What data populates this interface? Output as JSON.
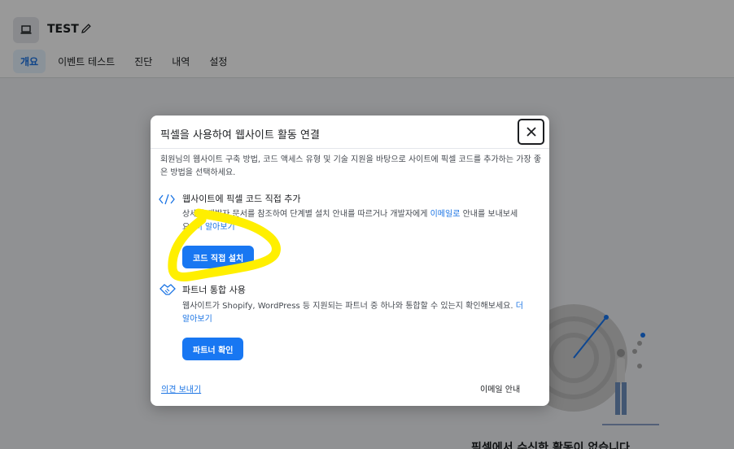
{
  "header": {
    "title": "TEST",
    "app_icon": "laptop-icon",
    "edit_icon": "pencil-icon",
    "tabs": [
      {
        "label": "개요",
        "active": true
      },
      {
        "label": "이벤트 테스트",
        "active": false
      },
      {
        "label": "진단",
        "active": false
      },
      {
        "label": "내역",
        "active": false
      },
      {
        "label": "설정",
        "active": false
      }
    ]
  },
  "background": {
    "bottom_text": "픽셀에서 수신한 활동이 없습니다"
  },
  "modal": {
    "title": "픽셀을 사용하여 웹사이트 활동 연결",
    "close_icon": "close-icon",
    "description": "회원님의 웹사이트 구축 방법, 코드 액세스 유형 및 기술 지원을 바탕으로 사이트에 픽셀 코드를 추가하는 가장 좋은 방법을 선택하세요.",
    "option_manual": {
      "icon": "code-icon",
      "title": "웹사이트에 픽셀 코드 직접 추가",
      "desc": "상세한 개발자 문서를 참조하여 단계별 설치 안내를 따르거나 개발자에게 ",
      "email_link": "이메일로",
      "desc_tail": " 안내를 보내보세요. ",
      "learn_more": "더 알아보기",
      "button": "코드 직접 설치"
    },
    "option_partner": {
      "icon": "handshake-icon",
      "title": "파트너 통합 사용",
      "desc": "웹사이트가 Shopify, WordPress 등 지원되는 파트너 중 하나와 통합할 수 있는지 확인해보세요. ",
      "learn_more": "더 알아보기",
      "button": "파트너 확인"
    },
    "footer": {
      "feedback_link": "의견 보내기",
      "email_guide": "이메일 안내"
    }
  },
  "colors": {
    "primary": "#1877f2",
    "link": "#1b74e4",
    "annotation": "#ffef00"
  }
}
